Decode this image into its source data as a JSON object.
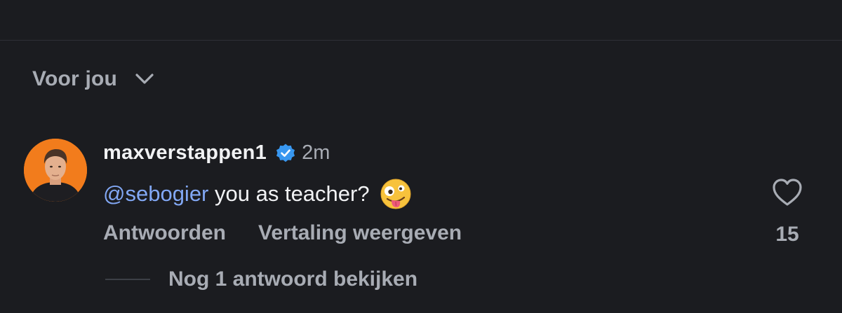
{
  "sort": {
    "label": "Voor jou",
    "icon": "chevron-down-icon"
  },
  "comment": {
    "username": "maxverstappen1",
    "verified": true,
    "timestamp": "2m",
    "mention": "@sebogier",
    "text": " you as teacher?",
    "emoji": "zany-face-emoji",
    "actions": {
      "reply": "Antwoorden",
      "translate": "Vertaling weergeven"
    },
    "likes": "15",
    "view_replies": "Nog 1 antwoord bekijken"
  },
  "colors": {
    "background": "#1b1c20",
    "mention": "#82a8f5",
    "verified": "#3897f0",
    "secondary_text": "#a8acb4"
  }
}
